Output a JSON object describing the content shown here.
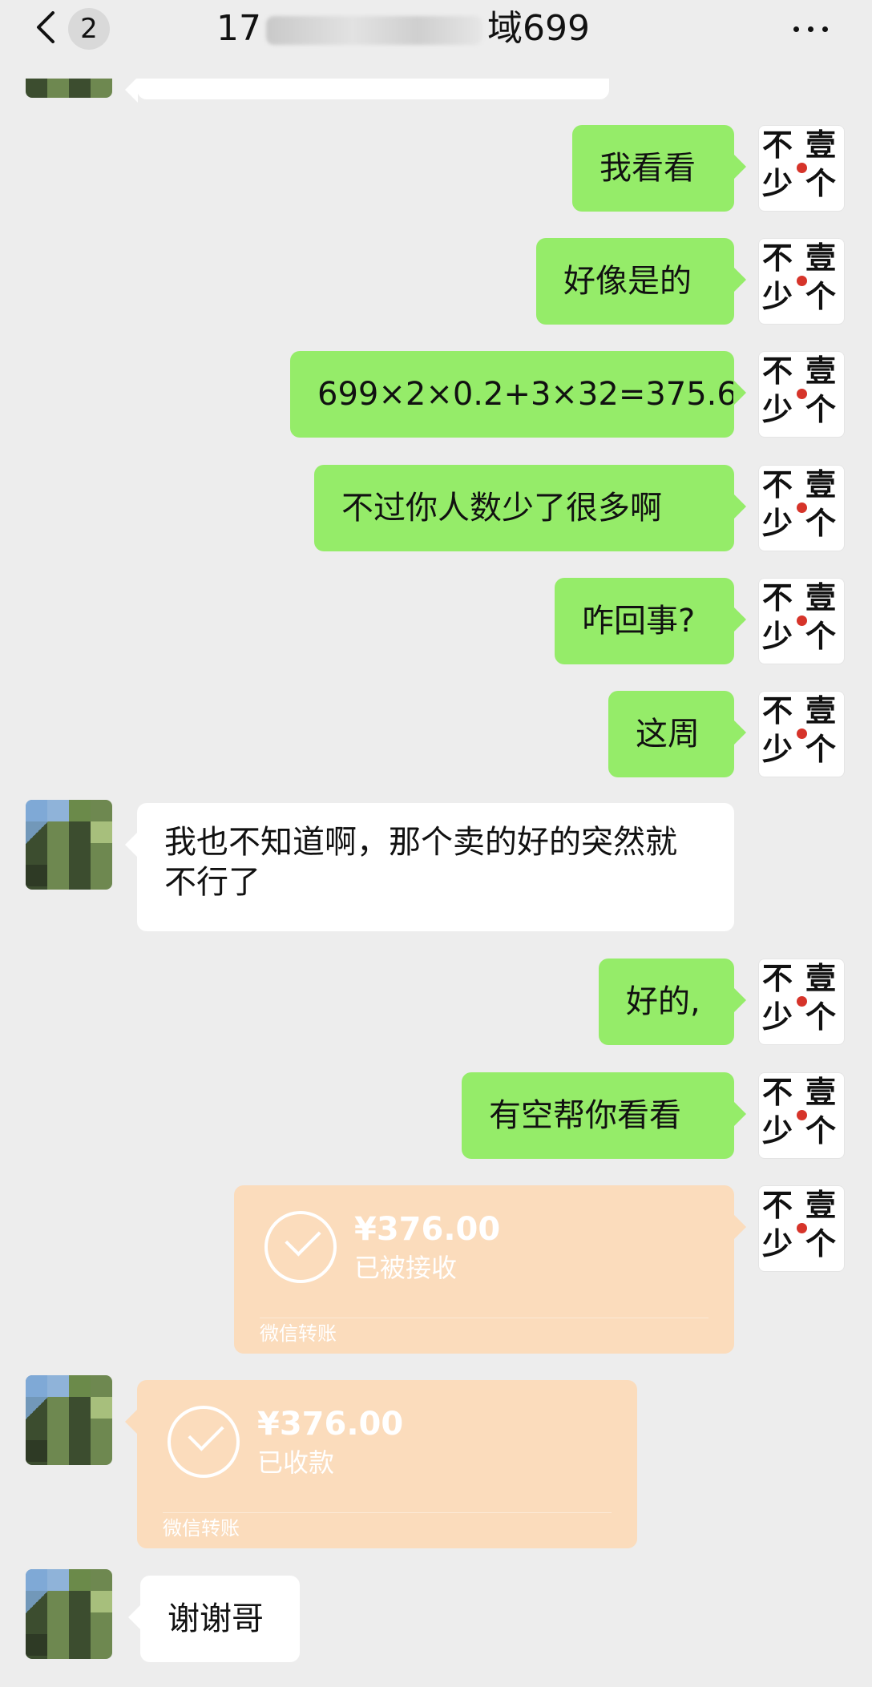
{
  "header": {
    "back_icon": "chevron-left-icon",
    "unread_count": "2",
    "title_prefix": "17",
    "title_suffix": "域699",
    "more_icon": "more-dots-icon"
  },
  "avatar_mine_text": "不少壹个",
  "messages": [
    {
      "side": "sent",
      "type": "text",
      "text": "我看看"
    },
    {
      "side": "sent",
      "type": "text",
      "text": "好像是的"
    },
    {
      "side": "sent",
      "type": "text",
      "text": "699×2×0.2+3×32=375.6"
    },
    {
      "side": "sent",
      "type": "text",
      "text": "不过你人数少了很多啊"
    },
    {
      "side": "sent",
      "type": "text",
      "text": "咋回事?"
    },
    {
      "side": "sent",
      "type": "text",
      "text": "这周"
    },
    {
      "side": "received",
      "type": "text",
      "text": "我也不知道啊，那个卖的好的突然就不行了"
    },
    {
      "side": "sent",
      "type": "text",
      "text": "好的,"
    },
    {
      "side": "sent",
      "type": "text",
      "text": "有空帮你看看"
    },
    {
      "side": "sent",
      "type": "transfer",
      "amount": "¥376.00",
      "status": "已被接收",
      "source": "微信转账"
    },
    {
      "side": "received",
      "type": "transfer",
      "amount": "¥376.00",
      "status": "已收款",
      "source": "微信转账"
    },
    {
      "side": "received",
      "type": "text",
      "text": "谢谢哥"
    }
  ],
  "colors": {
    "background": "#ededed",
    "sent_bubble": "#95ec69",
    "received_bubble": "#ffffff",
    "transfer_card": "#fbdcbc",
    "seal_red": "#d6342a"
  }
}
